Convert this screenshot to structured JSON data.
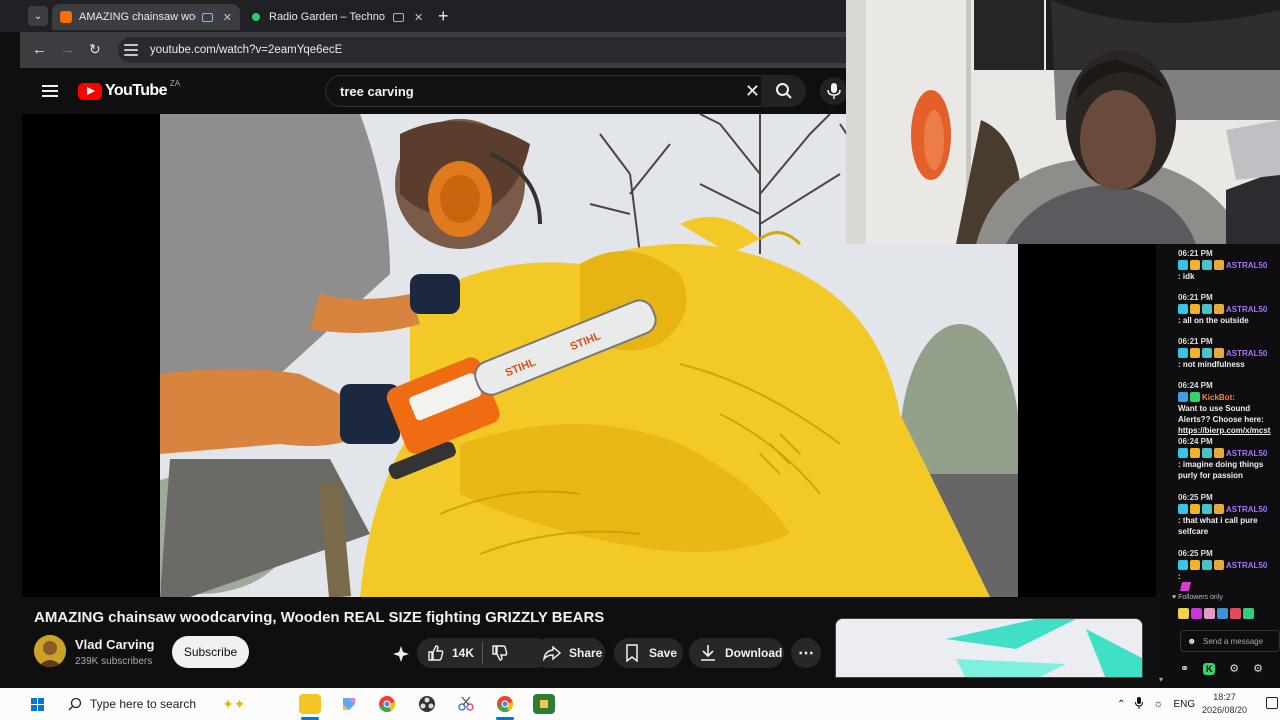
{
  "browser": {
    "tabs": [
      {
        "title": "AMAZING chainsaw woodc",
        "active": true
      },
      {
        "title": "Radio Garden – Techno Unc",
        "active": false
      }
    ],
    "url": "youtube.com/watch?v=2eamYqe6ecE"
  },
  "youtube": {
    "logo_text": "YouTube",
    "country_code": "ZA",
    "search_query": "tree carving"
  },
  "video": {
    "title": "AMAZING chainsaw woodcarving, Wooden REAL SIZE fighting GRIZZLY BEARS",
    "channel": "Vlad Carving",
    "subscribers": "239K subscribers",
    "subscribe_label": "Subscribe",
    "likes": "14K",
    "share_label": "Share",
    "save_label": "Save",
    "download_label": "Download",
    "saw_brand": "STIHL"
  },
  "chat": {
    "messages": [
      {
        "time": "06:21 PM",
        "user": "ASTRAL50",
        "text": ": idk"
      },
      {
        "time": "06:21 PM",
        "user": "ASTRAL50",
        "text": ": all on the outside"
      },
      {
        "time": "06:21 PM",
        "user": "ASTRAL50",
        "text": ": not mindfulness"
      },
      {
        "time": "06:24 PM",
        "user": "KickBot:",
        "text": "Want to use Sound Alerts?? Choose here:",
        "link": "https://bierp.com/x/mcst"
      },
      {
        "time": "06:24 PM",
        "user": "ASTRAL50",
        "text": ": imagine doing things purly for passion"
      },
      {
        "time": "06:25 PM",
        "user": "ASTRAL50",
        "text": ": that what i call pure selfcare"
      },
      {
        "time": "06:25 PM",
        "user": "ASTRAL50",
        "text": ":"
      }
    ],
    "followers_only": "Followers only",
    "input_placeholder": "Send a message"
  },
  "taskbar": {
    "search_placeholder": "Type here to search",
    "language": "ENG",
    "time": "18:27",
    "date": "2026/08/20"
  },
  "colors": {
    "youtube_red": "#ff0000",
    "chat_username": "#a970ff",
    "kickbot": "#ff7f50",
    "windows_blue": "#0078d4"
  }
}
